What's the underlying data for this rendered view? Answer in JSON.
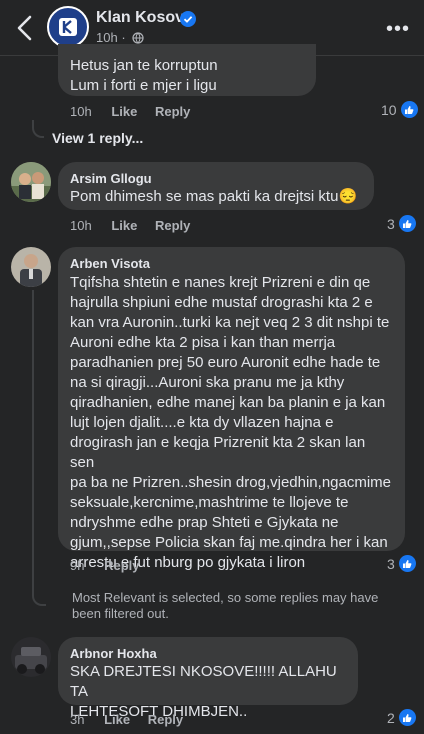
{
  "header": {
    "page_name": "Klan Kosova",
    "time": "10h",
    "dot": "·"
  },
  "comments": [
    {
      "author": "",
      "text_lines": [
        "Hetus jan te korruptun",
        "Lum i forti e mjer i ligu"
      ],
      "time": "10h",
      "like": "Like",
      "reply": "Reply",
      "reactions": "10"
    },
    {
      "author": "Arsim Gllogu",
      "text": "Pom dhimesh se mas pakti ka drejtsi ktu😔",
      "time": "10h",
      "like": "Like",
      "reply": "Reply",
      "reactions": "3"
    },
    {
      "author": "Arben Visota",
      "text_lines": [
        "Tqifsha shtetin e nanes krejt Prizreni e din qe",
        "hajrulla shpiuni edhe mustaf drograshi kta 2 e",
        "kan vra Auronin..turki ka nejt veq 2 3 dit nshpi te",
        "Auroni edhe kta 2 pisa i kan than merrja",
        "paradhanien prej 50 euro Auronit edhe hade te",
        "na si qiragji...Auroni ska pranu me ja kthy",
        "qiradhanien, edhe manej kan ba planin e  ja kan",
        "lujt lojen djalit....e kta dy vllazen hajna e",
        "drogirash jan e keqja Prizrenit kta 2 skan lan sen",
        "pa ba ne Prizren..shesin drog,vjedhin,ngacmime",
        "seksuale,kercnime,mashtrime te llojeve te",
        "ndryshme edhe prap Shteti e Gjykata ne",
        "gjum,,sepse Policia skan faj me.qindra her i kan",
        "arrestu e fut nburg po gjykata i liron"
      ],
      "time": "9h",
      "reply": "Reply",
      "reactions": "3"
    },
    {
      "author": "Arbnor Hoxha",
      "text_lines": [
        "SKA DREJTESI NKOSOVE!!!!! ALLAHU TA",
        "LEHTESOFT DHIMBJEN.."
      ],
      "time": "3h",
      "like": "Like",
      "reply": "Reply",
      "reactions": "2"
    }
  ],
  "view_replies": "View 1 reply...",
  "filter_notice_lines": [
    "Most Relevant is selected, so some replies may have",
    "been filtered out."
  ],
  "colors": {
    "background": "#242526",
    "bubble": "#3a3b3c",
    "like_blue": "#1877f2"
  },
  "icons": [
    "back-arrow-icon",
    "verified-badge-icon",
    "globe-icon",
    "more-icon",
    "like-reaction-icon"
  ]
}
